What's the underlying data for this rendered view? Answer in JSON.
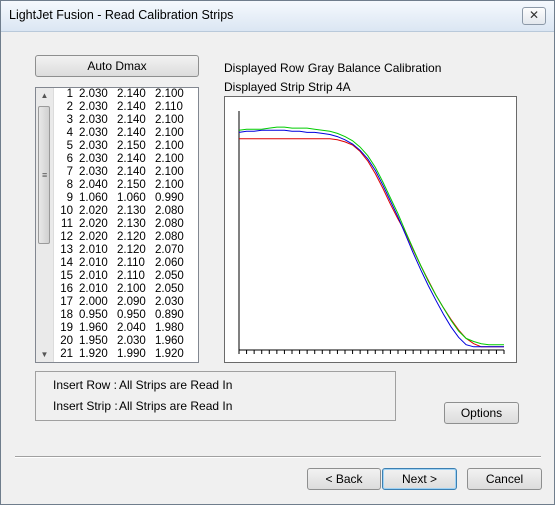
{
  "window": {
    "title": "LightJet Fusion - Read Calibration Strips",
    "close_glyph": "✕"
  },
  "auto_dmax_label": "Auto Dmax",
  "displayed_row": {
    "label": "Displayed Row :",
    "value": "Gray Balance Calibration"
  },
  "displayed_strip": {
    "label": "Displayed Strip :",
    "value": "Strip 4A"
  },
  "table_rows": [
    [
      "1",
      "2.030",
      "2.140",
      "2.100"
    ],
    [
      "2",
      "2.030",
      "2.140",
      "2.110"
    ],
    [
      "3",
      "2.030",
      "2.140",
      "2.100"
    ],
    [
      "4",
      "2.030",
      "2.140",
      "2.100"
    ],
    [
      "5",
      "2.030",
      "2.150",
      "2.100"
    ],
    [
      "6",
      "2.030",
      "2.140",
      "2.100"
    ],
    [
      "7",
      "2.030",
      "2.140",
      "2.100"
    ],
    [
      "8",
      "2.040",
      "2.150",
      "2.100"
    ],
    [
      "9",
      "1.060",
      "1.060",
      "0.990"
    ],
    [
      "10",
      "2.020",
      "2.130",
      "2.080"
    ],
    [
      "11",
      "2.020",
      "2.130",
      "2.080"
    ],
    [
      "12",
      "2.020",
      "2.120",
      "2.080"
    ],
    [
      "13",
      "2.010",
      "2.120",
      "2.070"
    ],
    [
      "14",
      "2.010",
      "2.110",
      "2.060"
    ],
    [
      "15",
      "2.010",
      "2.110",
      "2.050"
    ],
    [
      "16",
      "2.010",
      "2.100",
      "2.050"
    ],
    [
      "17",
      "2.000",
      "2.090",
      "2.030"
    ],
    [
      "18",
      "0.950",
      "0.950",
      "0.890"
    ],
    [
      "19",
      "1.960",
      "2.040",
      "1.980"
    ],
    [
      "20",
      "1.950",
      "2.030",
      "1.960"
    ],
    [
      "21",
      "1.920",
      "1.990",
      "1.920"
    ]
  ],
  "insert_row": {
    "label": "Insert Row :",
    "value": "All Strips are Read In"
  },
  "insert_strip": {
    "label": "Insert Strip :",
    "value": "All Strips are Read In"
  },
  "buttons": {
    "options": "Options",
    "back": "< Back",
    "next": "Next >",
    "cancel": "Cancel"
  },
  "chart_data": {
    "type": "line",
    "title": "",
    "xlabel": "",
    "ylabel": "",
    "x": [
      0,
      1,
      2,
      3,
      4,
      5,
      6,
      7,
      8,
      9,
      10,
      11,
      12,
      13,
      14,
      15,
      16,
      17,
      18,
      19,
      20,
      21,
      22,
      23,
      24,
      25,
      26,
      27,
      28,
      29,
      30,
      31,
      32,
      33,
      34,
      35
    ],
    "ylim": [
      0,
      2.3
    ],
    "grid": false,
    "ticks_x": 35,
    "series": [
      {
        "color": "#dd0000",
        "values": [
          2.0,
          2.0,
          2.0,
          2.0,
          2.0,
          2.0,
          2.0,
          2.0,
          2.0,
          2.0,
          2.0,
          2.0,
          2.0,
          1.99,
          1.97,
          1.94,
          1.88,
          1.79,
          1.67,
          1.53,
          1.38,
          1.24,
          1.11,
          0.95,
          0.8,
          0.66,
          0.52,
          0.4,
          0.29,
          0.19,
          0.11,
          0.06,
          0.03,
          0.03,
          0.03,
          0.03
        ]
      },
      {
        "color": "#0000dd",
        "values": [
          2.06,
          2.07,
          2.07,
          2.08,
          2.08,
          2.08,
          2.08,
          2.07,
          2.07,
          2.06,
          2.06,
          2.05,
          2.04,
          2.02,
          1.99,
          1.95,
          1.89,
          1.81,
          1.7,
          1.56,
          1.41,
          1.26,
          1.09,
          0.92,
          0.76,
          0.61,
          0.47,
          0.34,
          0.22,
          0.12,
          0.05,
          0.03,
          0.03,
          0.03,
          0.03,
          0.03
        ]
      },
      {
        "color": "#00cc00",
        "values": [
          2.08,
          2.09,
          2.09,
          2.09,
          2.1,
          2.11,
          2.11,
          2.1,
          2.1,
          2.1,
          2.09,
          2.08,
          2.07,
          2.05,
          2.02,
          1.98,
          1.92,
          1.84,
          1.73,
          1.59,
          1.44,
          1.29,
          1.12,
          0.96,
          0.8,
          0.65,
          0.52,
          0.4,
          0.28,
          0.18,
          0.11,
          0.08,
          0.06,
          0.05,
          0.05,
          0.05
        ]
      }
    ]
  }
}
